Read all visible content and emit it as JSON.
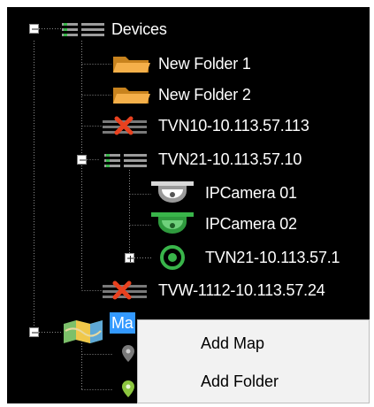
{
  "tree": {
    "devices": {
      "label": "Devices",
      "icon": "device-group-icon"
    },
    "new_folder_1": {
      "label": "New Folder 1",
      "icon": "folder-icon"
    },
    "new_folder_2": {
      "label": "New Folder 2",
      "icon": "folder-icon"
    },
    "tvn10": {
      "label": "TVN10-10.113.57.113",
      "icon": "offline-device-icon"
    },
    "tvn21": {
      "label": "TVN21-10.113.57.10",
      "icon": "device-group-icon"
    },
    "ipcamera_01": {
      "label": "IPCamera 01",
      "icon": "dome-camera-icon"
    },
    "ipcamera_02": {
      "label": "IPCamera 02",
      "icon": "dome-camera-icon"
    },
    "tvn21_sub": {
      "label": "TVN21-10.113.57.1",
      "icon": "ring-device-icon"
    },
    "tvw1112": {
      "label": "TVW-1112-10.113.57.24",
      "icon": "offline-device-icon"
    },
    "maps": {
      "label": "Ma",
      "icon": "map-icon"
    }
  },
  "context_menu": {
    "items": [
      {
        "label": "Add Map"
      },
      {
        "label": "Add Folder"
      }
    ]
  },
  "colors": {
    "background": "#000000",
    "selection": "#3399ff",
    "camera_green": "#39b54a",
    "offline_red": "#e8411f",
    "folder_orange": "#f5a623"
  }
}
